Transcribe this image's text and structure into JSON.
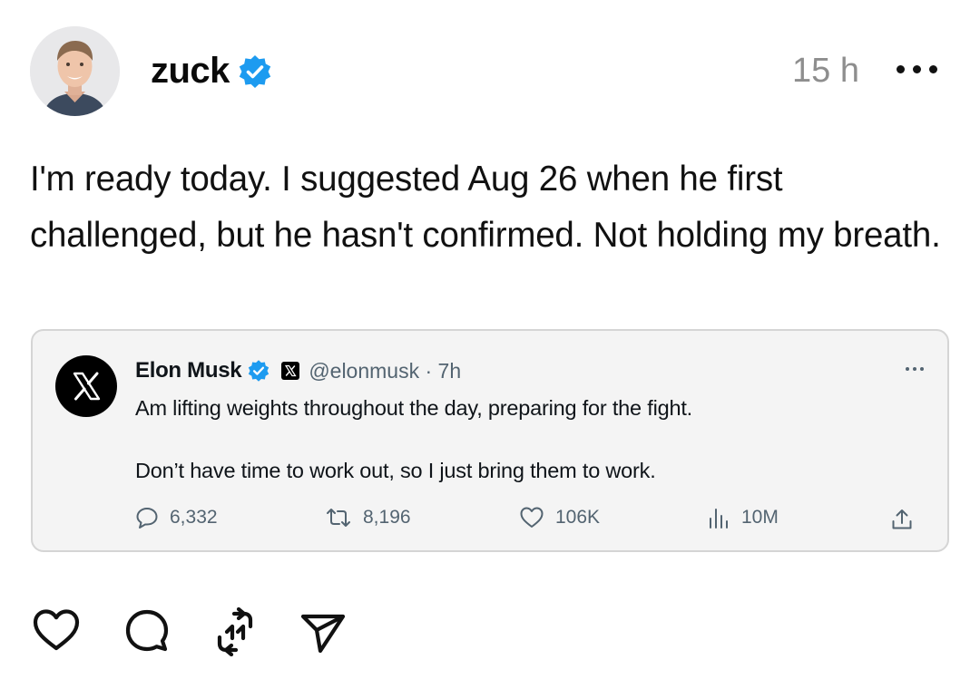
{
  "post": {
    "username": "zuck",
    "timestamp": "15 h",
    "text": "I'm ready today. I suggested Aug 26 when he first challenged, but he hasn't confirmed. Not holding my breath."
  },
  "quote": {
    "name": "Elon Musk",
    "handle_time": "@elonmusk · 7h",
    "line1": "Am lifting weights throughout the day, preparing for the fight.",
    "line2": "Don’t have time to work out, so I just bring them to work.",
    "replies": "6,332",
    "reposts": "8,196",
    "likes": "106K",
    "views": "10M"
  },
  "icons": {
    "verified": "verified-check-icon",
    "more": "ellipsis-icon",
    "x_logo": "x-logo-icon",
    "reply": "reply-bubble-icon",
    "repost": "repost-icon",
    "like": "heart-icon",
    "views": "bar-chart-icon",
    "share": "share-upload-icon",
    "send": "send-paper-plane-icon"
  },
  "colors": {
    "verified": "#1d9bf0",
    "muted": "#8e8e8e",
    "quote_bg": "#f4f4f4",
    "quote_meta": "#536471"
  }
}
